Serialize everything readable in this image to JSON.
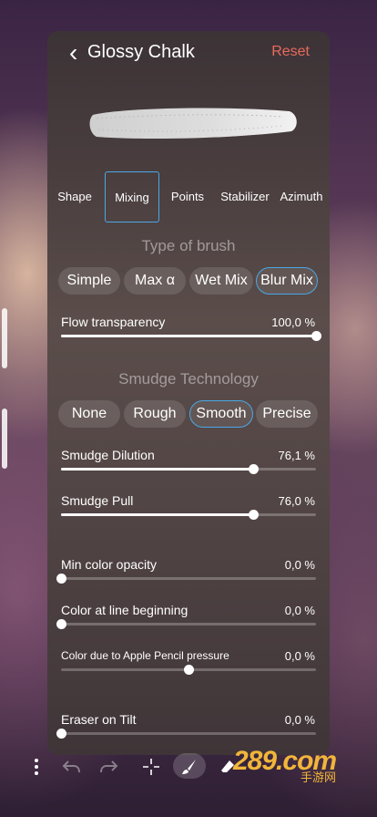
{
  "header": {
    "title": "Glossy Chalk",
    "back_glyph": "‹",
    "reset_label": "Reset"
  },
  "tabs": [
    {
      "label": "Shape"
    },
    {
      "label": "Mixing"
    },
    {
      "label": "Points"
    },
    {
      "label": "Stabilizer"
    },
    {
      "label": "Azimuth"
    }
  ],
  "active_tab": "Mixing",
  "brush_type": {
    "title": "Type of brush",
    "options": [
      "Simple",
      "Max α",
      "Wet Mix",
      "Blur Mix"
    ],
    "selected": "Blur Mix"
  },
  "flow": {
    "label": "Flow transparency",
    "value_text": "100,0 %",
    "fraction": 1.0
  },
  "smudge": {
    "title": "Smudge Technology",
    "options": [
      "None",
      "Rough",
      "Smooth",
      "Precise"
    ],
    "selected": "Smooth"
  },
  "sliders": [
    {
      "label": "Smudge Dilution",
      "value_text": "76,1 %",
      "fraction": 0.755
    },
    {
      "label": "Smudge Pull",
      "value_text": "76,0 %",
      "fraction": 0.755
    },
    {
      "label": "Min color opacity",
      "value_text": "0,0 %",
      "fraction": 0.0
    },
    {
      "label": "Color at line beginning",
      "value_text": "0,0 %",
      "fraction": 0.0
    },
    {
      "label": "Color due to Apple Pencil pressure",
      "value_text": "0,0 %",
      "fraction": 0.5
    },
    {
      "label": "Eraser on Tilt",
      "value_text": "0,0 %",
      "fraction": 0.0
    }
  ],
  "toolbar": {
    "icons": [
      "more-icon",
      "undo-icon",
      "redo-icon",
      "transform-icon",
      "brush-icon",
      "eraser-icon"
    ]
  },
  "watermark": {
    "main": "289.com",
    "sub": "手游网"
  },
  "colors": {
    "accent": "#4aa8e6",
    "reset": "#e86a5e"
  }
}
